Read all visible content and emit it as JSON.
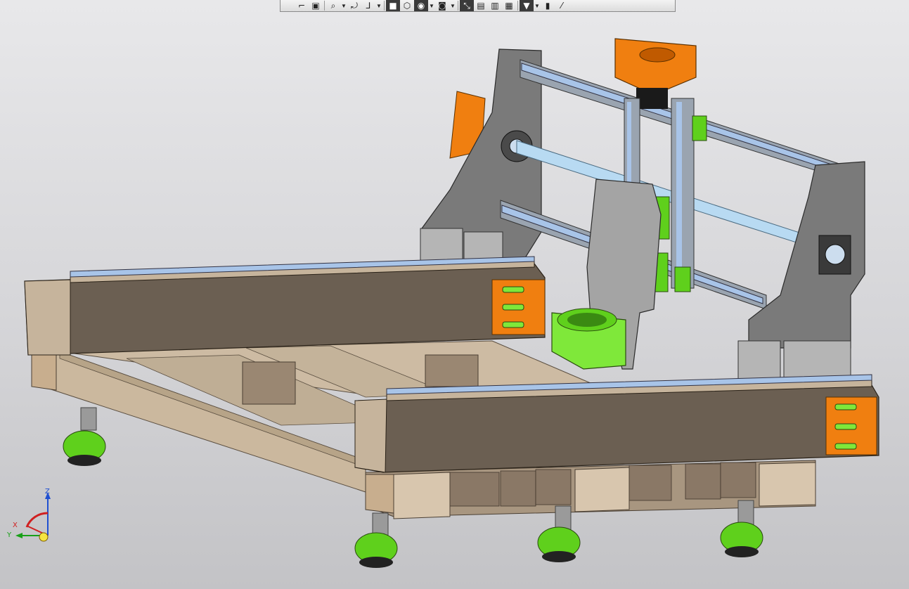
{
  "toolbar": {
    "buttons": [
      {
        "name": "view-orient-icon",
        "glyph": "⌐",
        "dark": false
      },
      {
        "name": "section-view-icon",
        "glyph": "▣",
        "dark": false
      },
      {
        "name": "zoom-icon",
        "glyph": "⌕",
        "dark": false,
        "dropdown": true
      },
      {
        "name": "rotate-icon",
        "glyph": "⤾",
        "dark": false
      },
      {
        "name": "coordinate-system-icon",
        "glyph": "⅃",
        "dark": false,
        "dropdown": true
      },
      {
        "name": "shaded-view-icon",
        "glyph": "■",
        "dark": true
      },
      {
        "name": "wireframe-view-icon",
        "glyph": "⬡",
        "dark": false
      },
      {
        "name": "hide-show-icon",
        "glyph": "◉",
        "dark": true,
        "dropdown": true
      },
      {
        "name": "camera-icon",
        "glyph": "◙",
        "dark": false,
        "dropdown": true
      },
      {
        "name": "measure-icon",
        "glyph": "⤡",
        "dark": true
      },
      {
        "name": "part-icon",
        "glyph": "▤",
        "dark": false
      },
      {
        "name": "assembly-icon",
        "glyph": "▥",
        "dark": false
      },
      {
        "name": "drawing-icon",
        "glyph": "▦",
        "dark": false
      },
      {
        "name": "filter-icon",
        "glyph": "▼",
        "dark": true,
        "dropdown": true
      },
      {
        "name": "properties-icon",
        "glyph": "▮",
        "dark": false
      },
      {
        "name": "pipette-icon",
        "glyph": "⁄",
        "dark": false
      }
    ]
  },
  "axes": {
    "x": "X",
    "y": "Y",
    "z": "Z"
  },
  "colors": {
    "background_top": "#e8e8ea",
    "background_bottom": "#c3c3c6",
    "frame_wood": "#c6b49c",
    "frame_dark": "#6b5f52",
    "orange_accent": "#f07f10",
    "green_feet": "#5fd01c",
    "gantry_gray": "#7a7a7a",
    "rail_blue": "#a8c4e8"
  }
}
